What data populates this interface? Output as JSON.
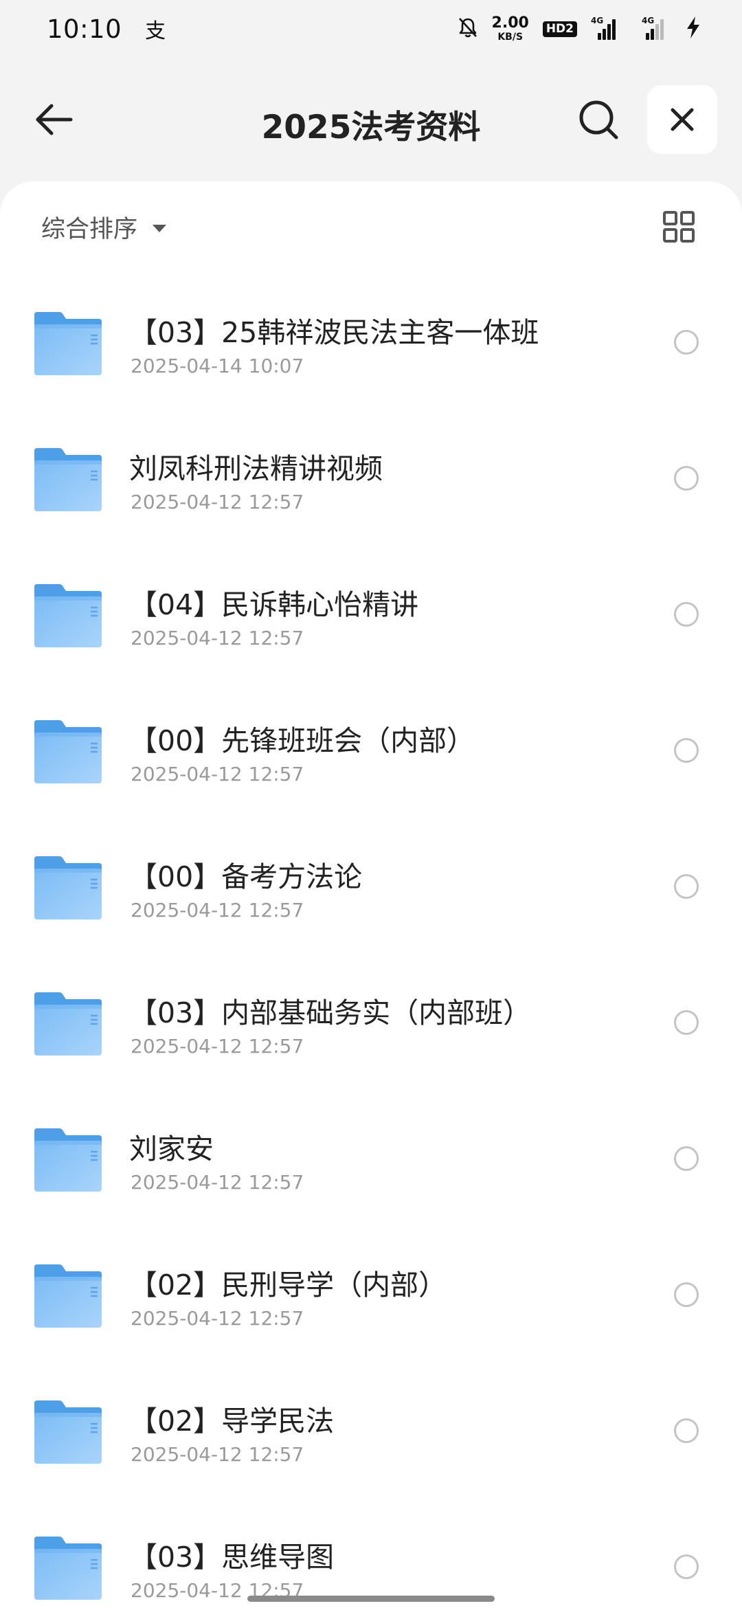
{
  "status_bar": {
    "time": "10:10",
    "app_glyph": "支",
    "net_speed_value": "2.00",
    "net_speed_unit": "KB/S",
    "hd_label": "HD2",
    "sim1_label": "4G",
    "sim2_label": "4G",
    "icons": [
      "mute-bell-icon",
      "signal-icon",
      "charging-bolt-icon"
    ]
  },
  "header": {
    "title": "2025法考资料",
    "icons": [
      "back-arrow-icon",
      "search-icon",
      "close-icon"
    ]
  },
  "toolbar": {
    "sort_label": "综合排序",
    "icons": [
      "caret-down-icon",
      "grid-view-icon"
    ]
  },
  "colors": {
    "folder_blue": "#6cb2f2",
    "background": "#f3f3f3",
    "sheet": "#ffffff",
    "date_gray": "#9a9a9a"
  },
  "files": [
    {
      "name": "【03】25韩祥波民法主客一体班",
      "date": "2025-04-14 10:07"
    },
    {
      "name": "刘凤科刑法精讲视频",
      "date": "2025-04-12 12:57"
    },
    {
      "name": "【04】民诉韩心怡精讲",
      "date": "2025-04-12 12:57"
    },
    {
      "name": "【00】先锋班班会（内部）",
      "date": "2025-04-12 12:57"
    },
    {
      "name": "【00】备考方法论",
      "date": "2025-04-12 12:57"
    },
    {
      "name": "【03】内部基础务实（内部班）",
      "date": "2025-04-12 12:57"
    },
    {
      "name": "刘家安",
      "date": "2025-04-12 12:57"
    },
    {
      "name": "【02】民刑导学（内部）",
      "date": "2025-04-12 12:57"
    },
    {
      "name": "【02】导学民法",
      "date": "2025-04-12 12:57"
    },
    {
      "name": "【03】思维导图",
      "date": "2025-04-12 12:57"
    }
  ]
}
